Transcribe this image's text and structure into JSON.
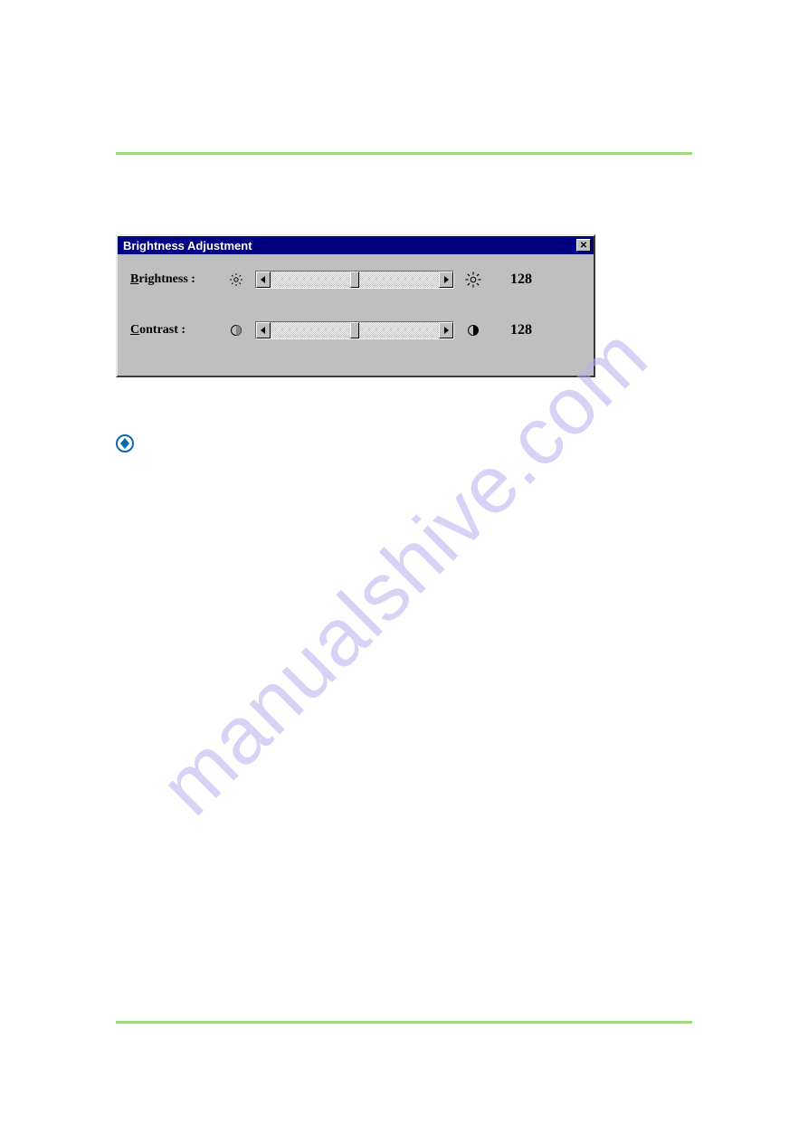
{
  "watermark": "manualshive.com",
  "dialog": {
    "title": "Brightness Adjustment",
    "brightness": {
      "label_underline": "B",
      "label_rest": "rightness :",
      "value": "128",
      "icon_left": "sun-dim-icon",
      "icon_right": "sun-bright-icon"
    },
    "contrast": {
      "label_underline": "C",
      "label_rest": "ontrast :",
      "value": "128",
      "icon_left": "circle-low-icon",
      "icon_right": "circle-half-icon"
    }
  }
}
